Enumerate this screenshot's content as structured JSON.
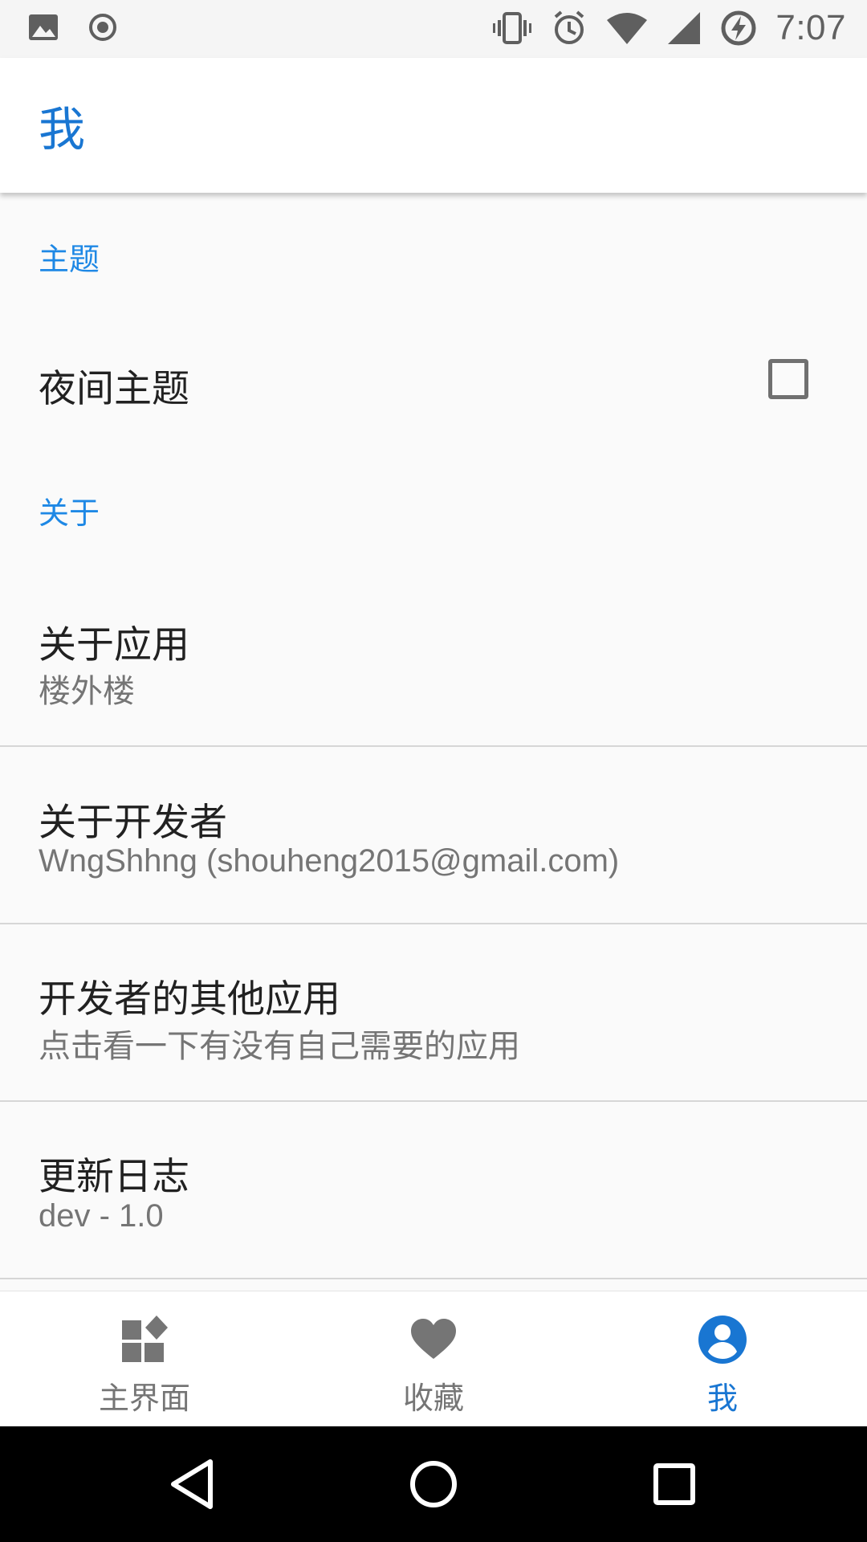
{
  "status_bar": {
    "time": "7:07",
    "icons": [
      "image-icon",
      "record-icon",
      "vibrate-icon",
      "alarm-icon",
      "wifi-icon",
      "cell-signal-icon",
      "battery-charging-icon"
    ]
  },
  "app_bar": {
    "title": "我"
  },
  "sections": [
    {
      "header": "主题",
      "items": [
        {
          "title": "夜间主题",
          "summary": "",
          "checkbox": false
        }
      ]
    },
    {
      "header": "关于",
      "items": [
        {
          "title": "关于应用",
          "summary": "楼外楼"
        },
        {
          "title": "关于开发者",
          "summary": "WngShhng (shouheng2015@gmail.com)"
        },
        {
          "title": "开发者的其他应用",
          "summary": "点击看一下有没有自己需要的应用"
        },
        {
          "title": "更新日志",
          "summary": "dev - 1.0"
        }
      ]
    }
  ],
  "bottom_nav": {
    "items": [
      {
        "label": "主界面",
        "icon": "dashboard-icon",
        "active": false
      },
      {
        "label": "收藏",
        "icon": "heart-icon",
        "active": false
      },
      {
        "label": "我",
        "icon": "account-circle-icon",
        "active": true
      }
    ]
  },
  "system_nav": {
    "buttons": [
      "back-icon",
      "home-icon",
      "recents-icon"
    ]
  },
  "colors": {
    "accent": "#1976d2",
    "background": "#fafafa",
    "inactive_nav": "#757575"
  }
}
